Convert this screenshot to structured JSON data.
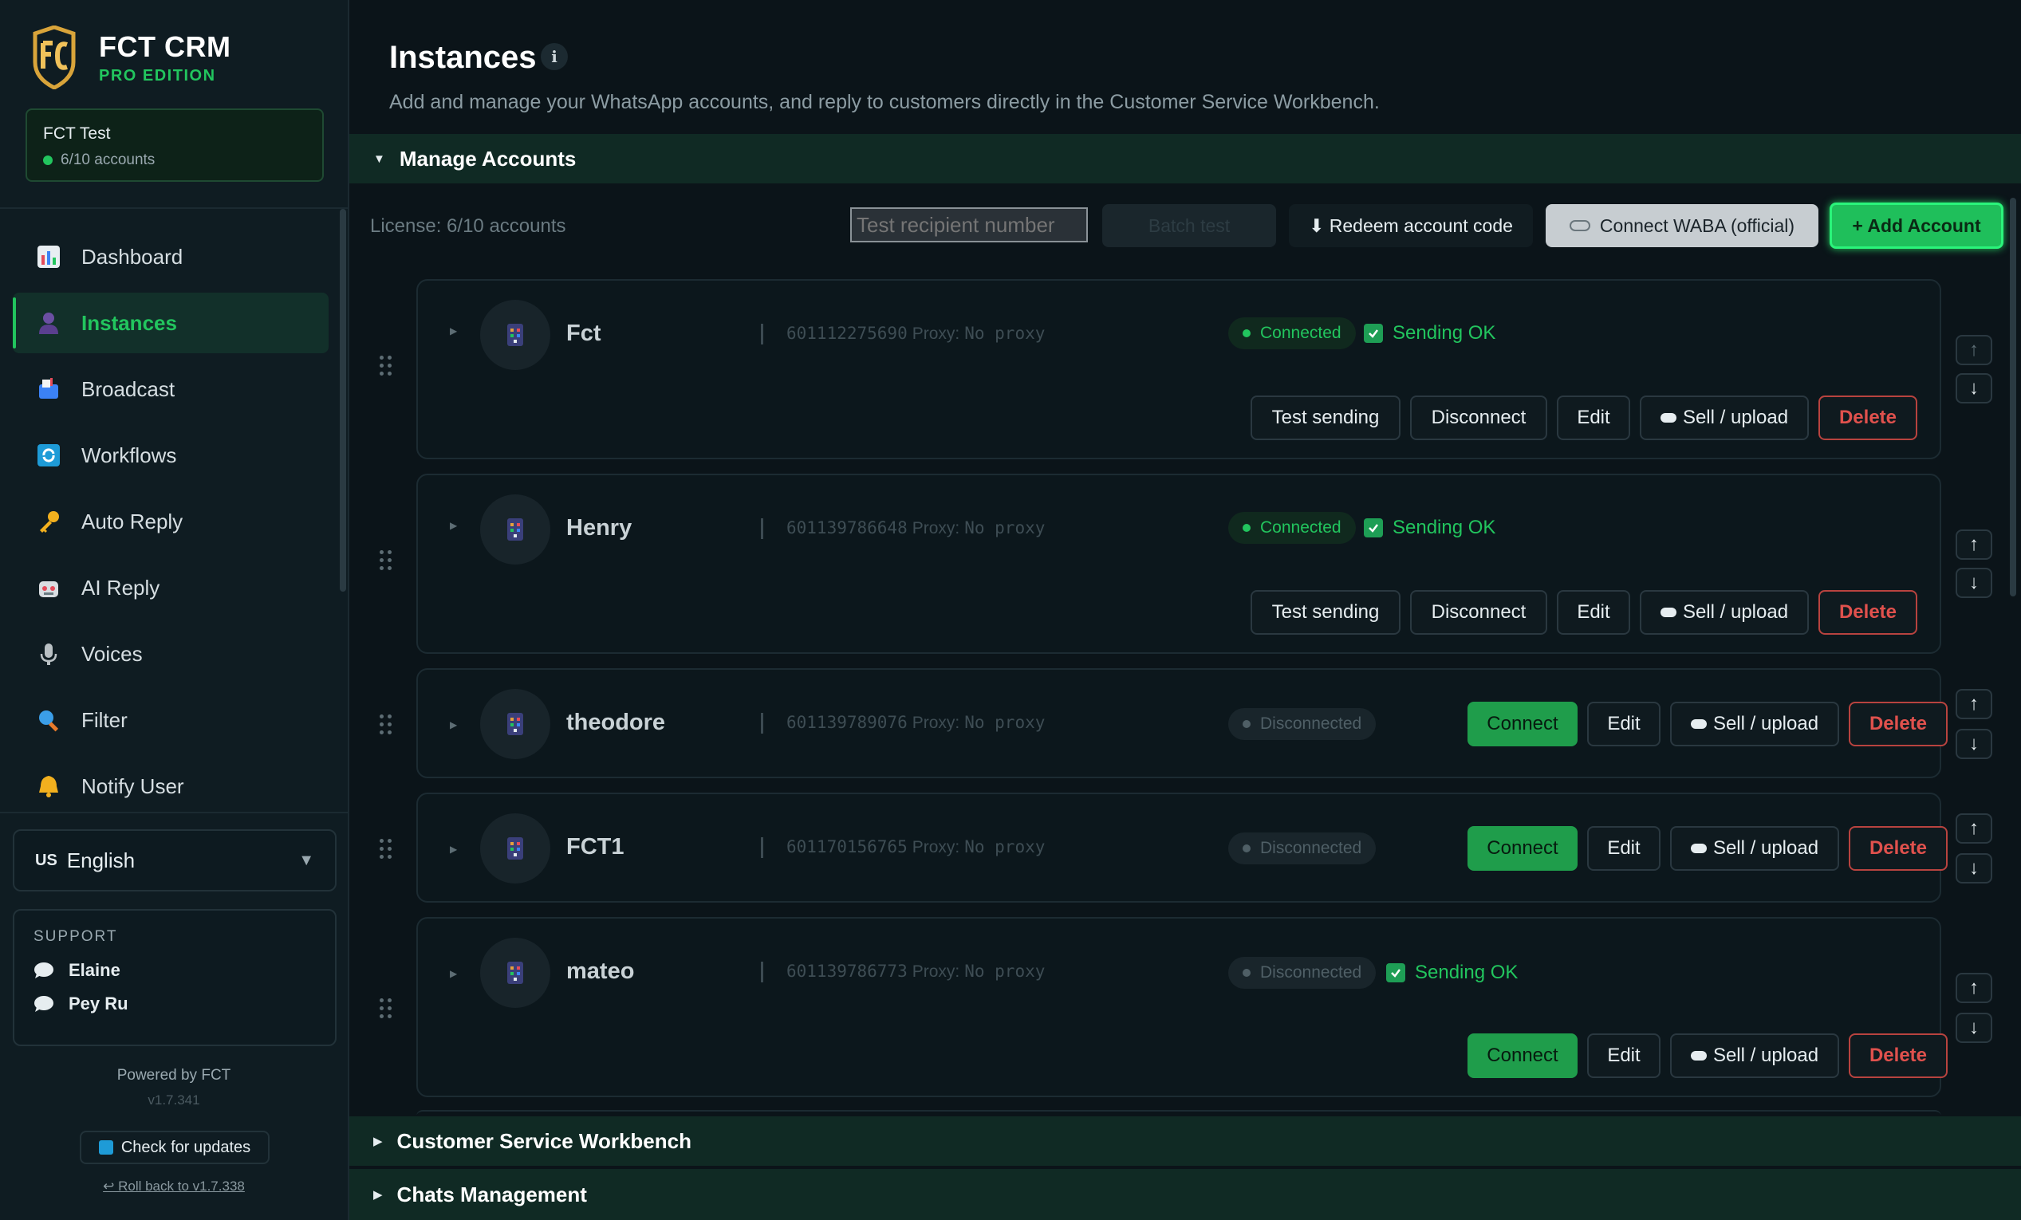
{
  "brand": {
    "name": "FCT CRM",
    "edition": "PRO EDITION"
  },
  "account": {
    "name": "FCT Test",
    "count": "6/10 accounts"
  },
  "nav": [
    {
      "label": "Dashboard",
      "icon": "chart-icon"
    },
    {
      "label": "Instances",
      "icon": "person-icon",
      "active": true
    },
    {
      "label": "Broadcast",
      "icon": "mailbox-icon"
    },
    {
      "label": "Workflows",
      "icon": "refresh-icon"
    },
    {
      "label": "Auto Reply",
      "icon": "key-icon"
    },
    {
      "label": "AI Reply",
      "icon": "robot-icon"
    },
    {
      "label": "Voices",
      "icon": "microphone-icon"
    },
    {
      "label": "Filter",
      "icon": "magnifier-icon"
    },
    {
      "label": "Notify User",
      "icon": "bell-icon"
    }
  ],
  "language": {
    "flag": "US",
    "value": "English"
  },
  "support": {
    "title": "SUPPORT",
    "contacts": [
      "Elaine",
      "Pey Ru"
    ]
  },
  "footer": {
    "powered": "Powered by FCT",
    "version": "v1.7.341",
    "check_updates": "Check for updates",
    "rollback": "↩ Roll back to v1.7.338"
  },
  "page": {
    "title": "Instances",
    "info": "i",
    "subtitle": "Add and manage your WhatsApp accounts, and reply to customers directly in the Customer Service Workbench."
  },
  "sections": {
    "manage": "Manage Accounts",
    "workbench": "Customer Service Workbench",
    "chats": "Chats Management"
  },
  "toolbar": {
    "license": "License: 6/10 accounts",
    "test_placeholder": "Test recipient number",
    "disabled_label": "Batch test",
    "redeem": "⬇ Redeem account code",
    "waba": "Connect WABA (official)",
    "add": "+ Add Account"
  },
  "labels": {
    "proxy": "Proxy:",
    "test_sending": "Test sending",
    "disconnect": "Disconnect",
    "connect": "Connect",
    "edit": "Edit",
    "sell": "Sell / upload",
    "delete": "Delete",
    "sending_ok": "Sending OK",
    "up": "↑",
    "down": "↓"
  },
  "accounts": [
    {
      "name": "Fct",
      "phone": "601112275690",
      "proxy": "No proxy",
      "status": "Connected",
      "sending_ok": true
    },
    {
      "name": "Henry",
      "phone": "601139786648",
      "proxy": "No proxy",
      "status": "Connected",
      "sending_ok": true
    },
    {
      "name": "theodore",
      "phone": "601139789076",
      "proxy": "No proxy",
      "status": "Disconnected",
      "sending_ok": false
    },
    {
      "name": "FCT1",
      "phone": "601170156765",
      "proxy": "No proxy",
      "status": "Disconnected",
      "sending_ok": false
    },
    {
      "name": "mateo",
      "phone": "601139786773",
      "proxy": "No proxy",
      "status": "Disconnected",
      "sending_ok": true
    }
  ],
  "colors": {
    "accent": "#22c55e",
    "danger": "#e0514d",
    "background": "#0b1419",
    "sidebar": "#0f1c22"
  }
}
